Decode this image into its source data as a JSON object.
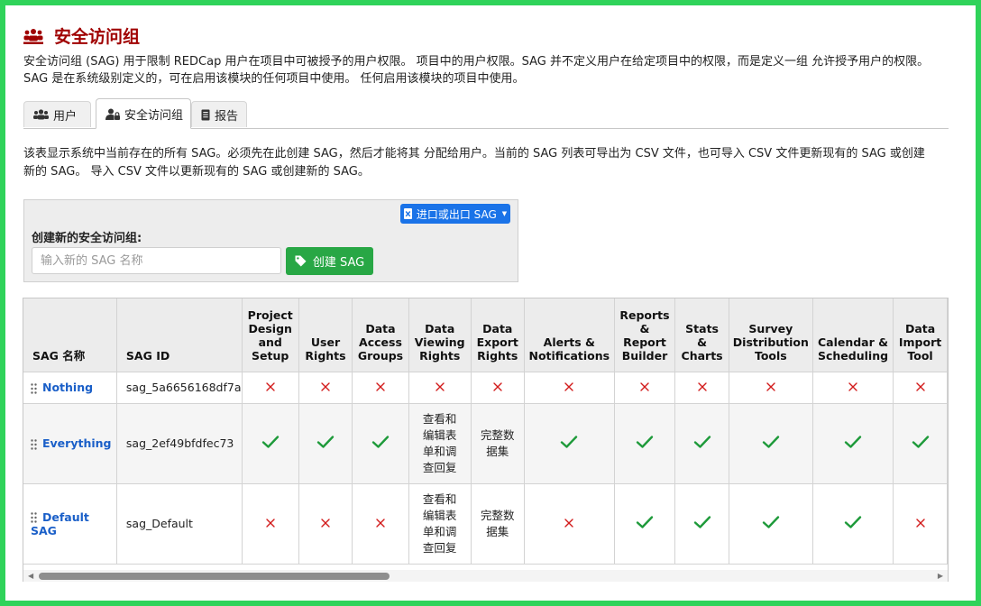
{
  "header": {
    "title": "安全访问组",
    "title_icon": "users-group-icon"
  },
  "intro": "安全访问组 (SAG) 用于限制 REDCap 用户在项目中可被授予的用户权限。 项目中的用户权限。SAG 并不定义用户在给定项目中的权限，而是定义一组 允许授予用户的权限。SAG 是在系统级别定义的，可在启用该模块的任何项目中使用。 任何启用该模块的项目中使用。",
  "tabs": [
    {
      "label": "用户",
      "icon": "users-icon"
    },
    {
      "label": "安全访问组",
      "icon": "user-lock-icon"
    },
    {
      "label": "报告",
      "icon": "report-icon"
    }
  ],
  "description": "该表显示系统中当前存在的所有 SAG。必须先在此创建 SAG，然后才能将其 分配给用户。当前的 SAG 列表可导出为 CSV 文件，也可导入 CSV 文件更新现有的 SAG 或创建新的 SAG。 导入 CSV 文件以更新现有的 SAG 或创建新的 SAG。",
  "panel": {
    "export_button": "进口或出口 SAG",
    "label": "创建新的安全访问组:",
    "input_placeholder": "输入新的 SAG 名称",
    "input_value": "",
    "create_button": "创建 SAG"
  },
  "table": {
    "headers": [
      "SAG 名称",
      "SAG ID",
      "Project Design and Setup",
      "User Rights",
      "Data Access Groups",
      "Data Viewing Rights",
      "Data Export Rights",
      "Alerts & Notifications",
      "Reports & Report Builder",
      "Stats & Charts",
      "Survey Distribution Tools",
      "Calendar & Scheduling",
      "Data Import Tool"
    ],
    "rows": [
      {
        "name": "Nothing",
        "id": "sag_5a6656168df7a",
        "cells": [
          {
            "t": "x"
          },
          {
            "t": "x"
          },
          {
            "t": "x"
          },
          {
            "t": "x"
          },
          {
            "t": "x"
          },
          {
            "t": "x"
          },
          {
            "t": "x"
          },
          {
            "t": "x"
          },
          {
            "t": "x"
          },
          {
            "t": "x"
          },
          {
            "t": "x"
          }
        ]
      },
      {
        "name": "Everything",
        "id": "sag_2ef49bfdfec73",
        "cells": [
          {
            "t": "check"
          },
          {
            "t": "check"
          },
          {
            "t": "check"
          },
          {
            "t": "text",
            "v": "查看和编辑表单和调查回复"
          },
          {
            "t": "text",
            "v": "完整数据集"
          },
          {
            "t": "check"
          },
          {
            "t": "check"
          },
          {
            "t": "check"
          },
          {
            "t": "check"
          },
          {
            "t": "check"
          },
          {
            "t": "check"
          }
        ]
      },
      {
        "name": "Default SAG",
        "id": "sag_Default",
        "cells": [
          {
            "t": "x"
          },
          {
            "t": "x"
          },
          {
            "t": "x"
          },
          {
            "t": "text",
            "v": "查看和编辑表单和调查回复"
          },
          {
            "t": "text",
            "v": "完整数据集"
          },
          {
            "t": "x"
          },
          {
            "t": "check"
          },
          {
            "t": "check"
          },
          {
            "t": "check"
          },
          {
            "t": "check"
          },
          {
            "t": "x"
          }
        ]
      }
    ]
  },
  "colors": {
    "accent_red": "#a00000",
    "link_blue": "#1a5fc8",
    "green": "#28a745",
    "blue_button": "#1a73e8",
    "cross_red": "#d21a1a",
    "frame_green": "#2fd35a"
  }
}
